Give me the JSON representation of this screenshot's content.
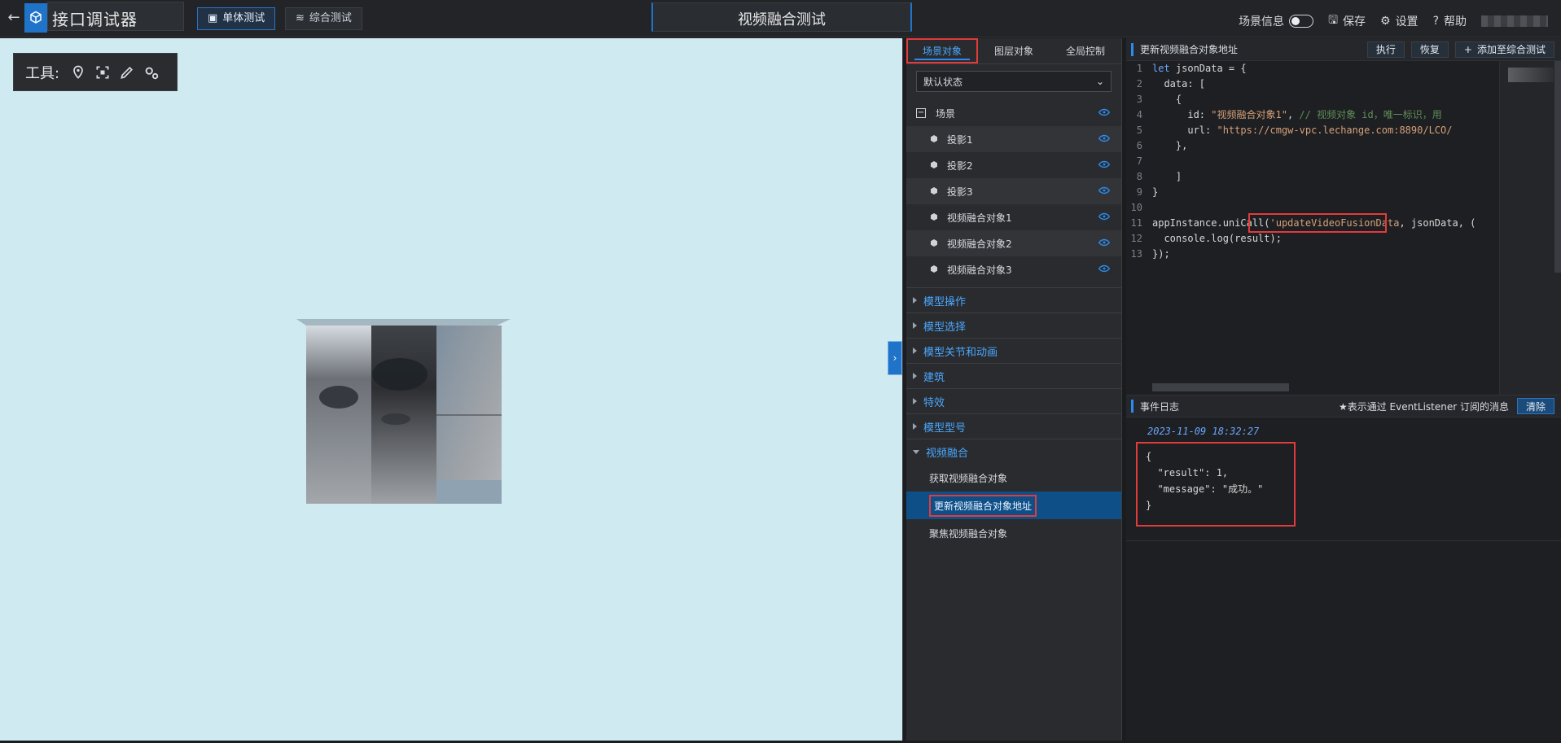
{
  "topbar": {
    "app_title": "接口调试器",
    "mode_buttons": [
      {
        "label": "单体测试"
      },
      {
        "label": "综合测试"
      }
    ],
    "page_title": "视频融合测试",
    "right": {
      "scene_info": "场景信息",
      "save": "保存",
      "settings": "设置",
      "help": "帮助"
    }
  },
  "viewport": {
    "tools_label": "工具:"
  },
  "left_panel": {
    "tabs": [
      "场景对象",
      "图层对象",
      "全局控制"
    ],
    "select_value": "默认状态",
    "tree": {
      "root_label": "场景",
      "children": [
        "投影1",
        "投影2",
        "投影3",
        "视频融合对象1",
        "视频融合对象2",
        "视频融合对象3"
      ]
    },
    "sections": [
      {
        "label": "模型操作"
      },
      {
        "label": "模型选择"
      },
      {
        "label": "模型关节和动画"
      },
      {
        "label": "建筑"
      },
      {
        "label": "特效"
      },
      {
        "label": "模型型号"
      },
      {
        "label": "视频融合",
        "expanded": true,
        "items": [
          "获取视频融合对象",
          "更新视频融合对象地址",
          "聚焦视频融合对象"
        ],
        "active_index": 1
      }
    ]
  },
  "editor": {
    "title": "更新视频融合对象地址",
    "buttons": {
      "run": "执行",
      "restore": "恢复",
      "add": "添加至综合测试"
    },
    "lines": [
      [
        {
          "t": "let ",
          "c": "k"
        },
        {
          "t": "jsonData = {",
          "c": "p"
        }
      ],
      [
        {
          "t": "  data: [",
          "c": "p"
        }
      ],
      [
        {
          "t": "    {",
          "c": "p"
        }
      ],
      [
        {
          "t": "      id: ",
          "c": "p"
        },
        {
          "t": "\"视频融合对象1\"",
          "c": "s"
        },
        {
          "t": ", ",
          "c": "p"
        },
        {
          "t": "// 视频对象 id，唯一标识，用",
          "c": "c"
        }
      ],
      [
        {
          "t": "      url: ",
          "c": "p"
        },
        {
          "t": "\"https://cmgw-vpc.lechange.com:8890/LCO/",
          "c": "s"
        }
      ],
      [
        {
          "t": "    },",
          "c": "p"
        }
      ],
      [
        {
          "t": "",
          "c": "p"
        }
      ],
      [
        {
          "t": "    ]",
          "c": "p"
        }
      ],
      [
        {
          "t": "}",
          "c": "p"
        }
      ],
      [
        {
          "t": "",
          "c": "p"
        }
      ],
      [
        {
          "t": "appInstance.uniCall(",
          "c": "p"
        },
        {
          "t": "'updateVideoFusionData",
          "c": "s"
        },
        {
          "t": ", jsonData, (",
          "c": "p"
        }
      ],
      [
        {
          "t": "  console.log(result);",
          "c": "p"
        }
      ],
      [
        {
          "t": "});",
          "c": "p"
        }
      ]
    ]
  },
  "log": {
    "title": "事件日志",
    "note": "★表示通过 EventListener 订阅的消息",
    "clear": "清除",
    "time": "2023-11-09 18:32:27",
    "json_lines": [
      "{",
      "  \"result\": 1,",
      "  \"message\": \"成功。\"",
      "}"
    ]
  },
  "colors": {
    "accent": "#2a8cf0",
    "highlight_red": "#e23b3b",
    "active_item": "#0f4f88",
    "viewport_bg": "#cfeaf1"
  }
}
